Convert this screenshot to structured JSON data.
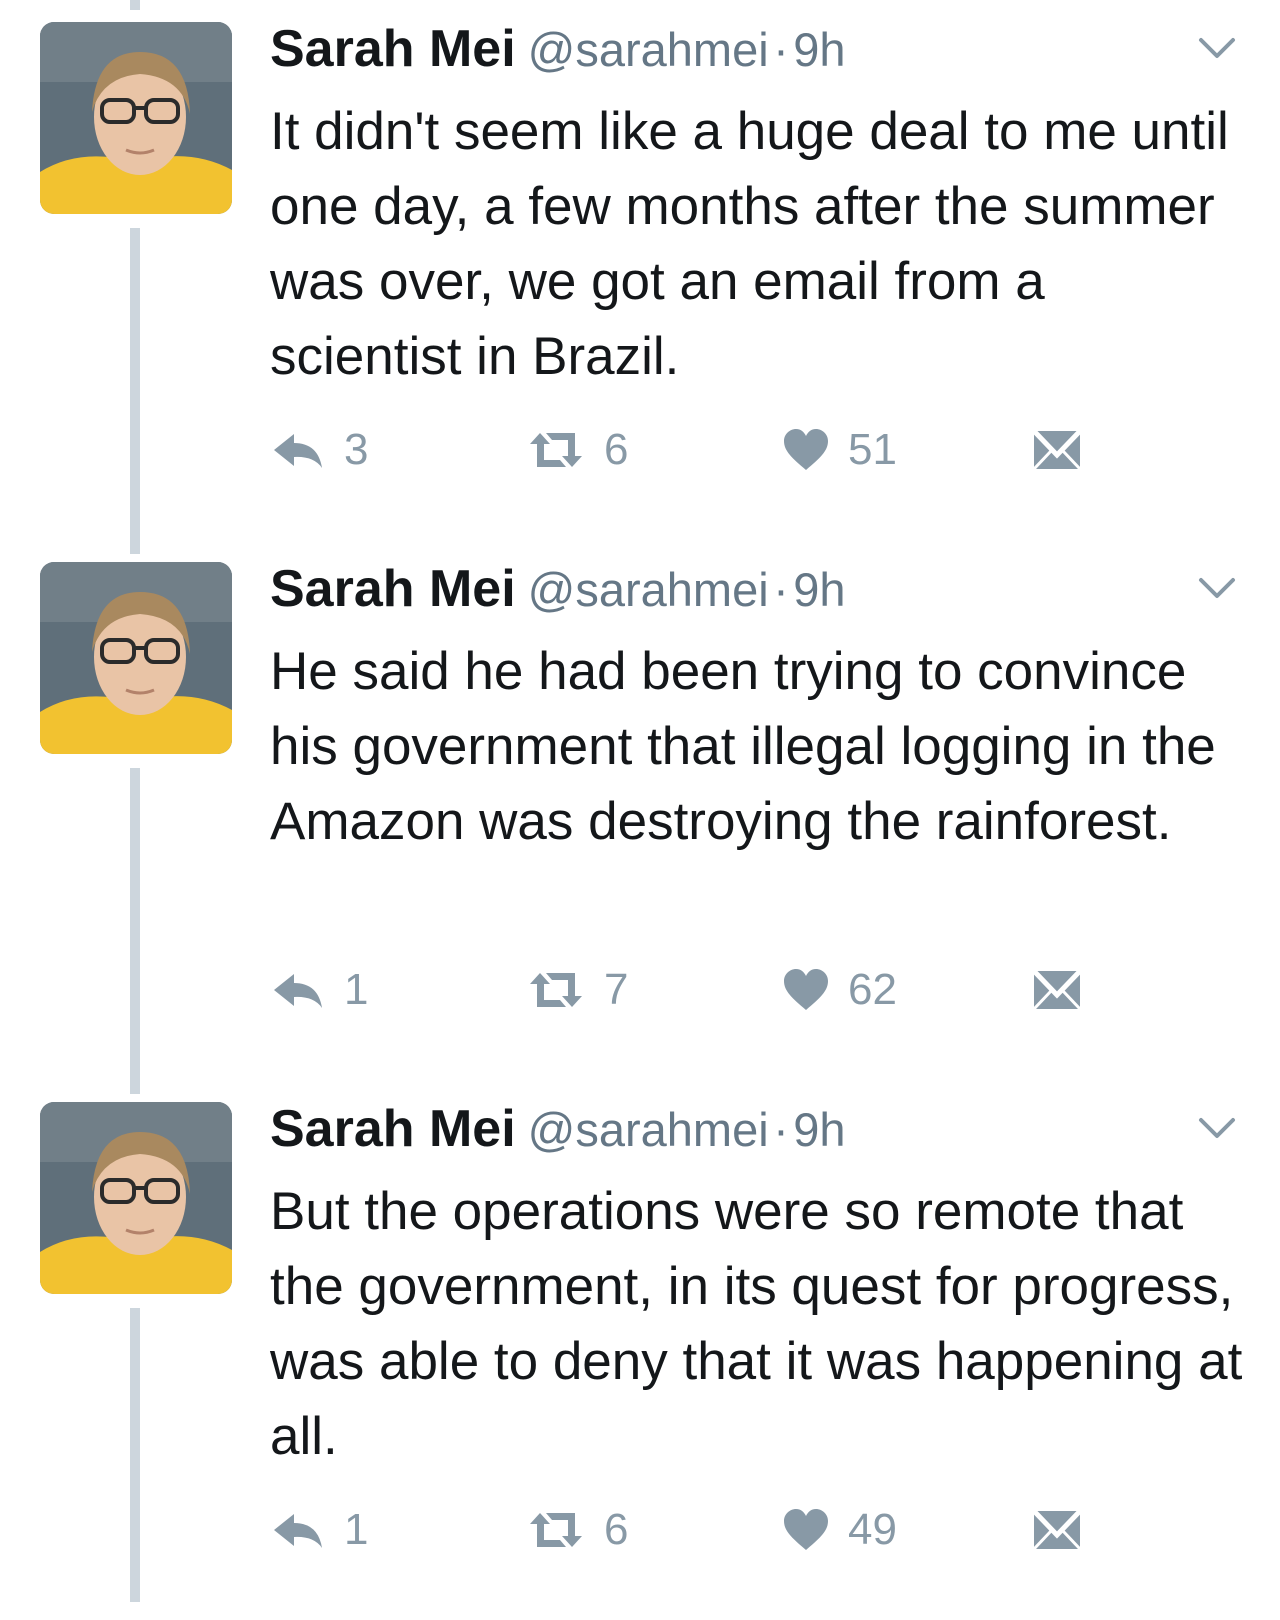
{
  "colors": {
    "text": "#14171a",
    "secondary": "#657786",
    "action_gray": "#8899a6",
    "thread_line": "#cdd6dd",
    "avatar_shirt": "#f2c230"
  },
  "icons": {
    "reply": "reply-icon",
    "retweet": "retweet-icon",
    "like": "heart-icon",
    "direct_message": "envelope-icon",
    "more": "chevron-down-icon"
  },
  "tweets": [
    {
      "name": "Sarah Mei",
      "handle": "@sarahmei",
      "separator": "·",
      "time": "9h",
      "text": "It didn't seem like a huge deal to me until one day, a few months after the summer was over, we got an email from a scientist in Brazil.",
      "replies": "3",
      "retweets": "6",
      "likes": "51"
    },
    {
      "name": "Sarah Mei",
      "handle": "@sarahmei",
      "separator": "·",
      "time": "9h",
      "text": "He said he had been trying to convince his government that illegal logging in the Amazon was destroying the rainforest.",
      "replies": "1",
      "retweets": "7",
      "likes": "62"
    },
    {
      "name": "Sarah Mei",
      "handle": "@sarahmei",
      "separator": "·",
      "time": "9h",
      "text": "But the operations were so remote that the government, in its quest for progress, was able to deny that it was happening at all.",
      "replies": "1",
      "retweets": "6",
      "likes": "49"
    }
  ]
}
